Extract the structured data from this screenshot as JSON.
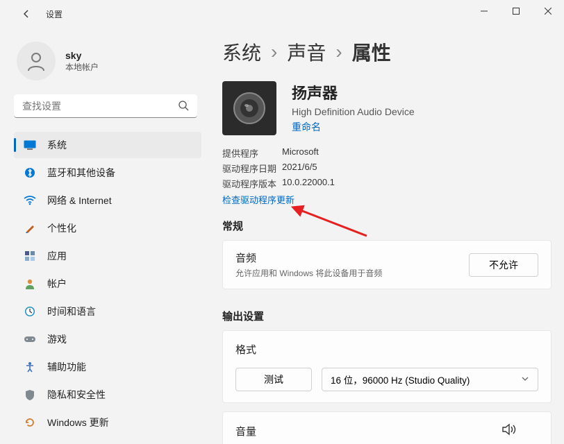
{
  "window": {
    "title": "设置"
  },
  "user": {
    "name": "sky",
    "subtitle": "本地帐户"
  },
  "search": {
    "placeholder": "查找设置"
  },
  "nav": [
    {
      "label": "系统"
    },
    {
      "label": "蓝牙和其他设备"
    },
    {
      "label": "网络 & Internet"
    },
    {
      "label": "个性化"
    },
    {
      "label": "应用"
    },
    {
      "label": "帐户"
    },
    {
      "label": "时间和语言"
    },
    {
      "label": "游戏"
    },
    {
      "label": "辅助功能"
    },
    {
      "label": "隐私和安全性"
    },
    {
      "label": "Windows 更新"
    }
  ],
  "breadcrumb": {
    "l1": "系统",
    "l2": "声音",
    "l3": "属性",
    "sep": "›"
  },
  "device": {
    "title": "扬声器",
    "subtitle": "High Definition Audio Device",
    "rename": "重命名"
  },
  "driver": {
    "provider_label": "提供程序",
    "provider_value": "Microsoft",
    "date_label": "驱动程序日期",
    "date_value": "2021/6/5",
    "version_label": "驱动程序版本",
    "version_value": "10.0.22000.1",
    "check_update": "检查驱动程序更新"
  },
  "general": {
    "title": "常规",
    "audio_label": "音频",
    "audio_desc": "允许应用和 Windows 将此设备用于音频",
    "block_button": "不允许"
  },
  "output": {
    "title": "输出设置",
    "format_label": "格式",
    "test_button": "测试",
    "format_value": "16 位，96000 Hz (Studio Quality)",
    "volume_label": "音量"
  }
}
